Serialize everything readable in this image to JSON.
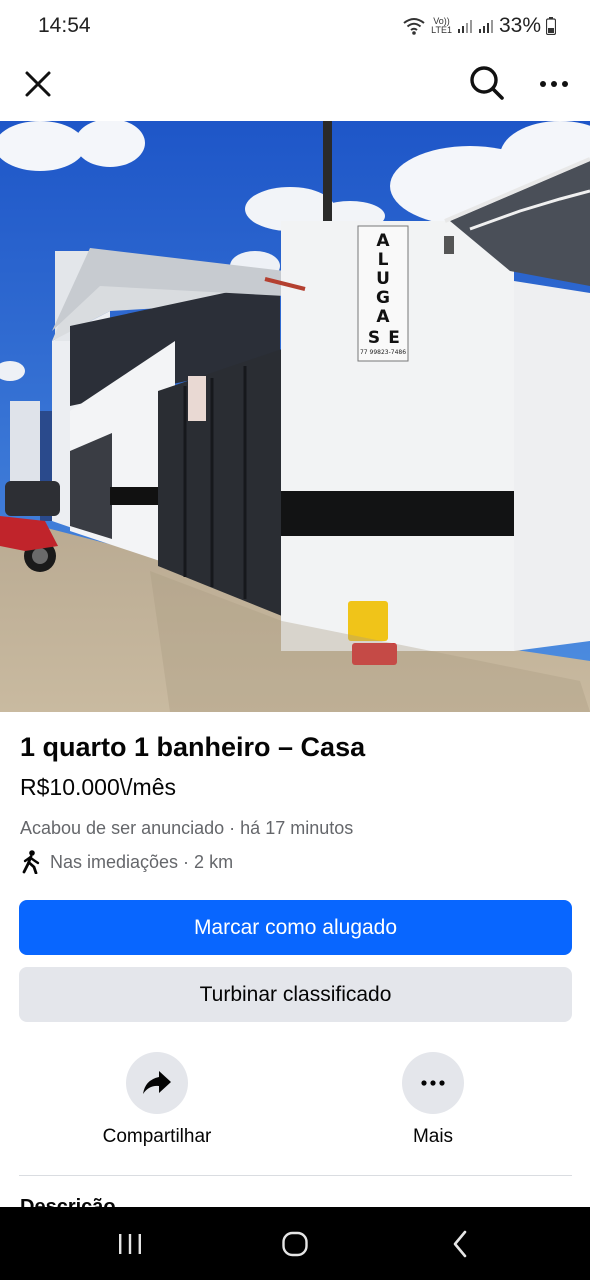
{
  "status_bar": {
    "time": "14:54",
    "network_label_top": "Vo))",
    "network_label_bottom": "LTE1",
    "battery": "33%"
  },
  "app_bar": {
    "close_icon": "close-icon",
    "search_icon": "search-icon",
    "more_icon": "more-horizontal-icon"
  },
  "photo": {
    "sign_letters": [
      "A",
      "L",
      "U",
      "G",
      "A",
      "S",
      "E"
    ],
    "sign_phone": "77 99823-7486"
  },
  "listing": {
    "title": "1 quarto 1 banheiro – Casa",
    "price": "R$10.000\\/mês",
    "posted": "Acabou de ser anunciado",
    "posted_time": " · há 17 minutos",
    "location_icon": "walking-person-icon",
    "location": "Nas imediações · 2 km"
  },
  "buttons": {
    "primary": "Marcar como alugado",
    "secondary": "Turbinar classificado"
  },
  "actions": [
    {
      "label": "Compartilhar",
      "icon": "share-icon"
    },
    {
      "label": "Mais",
      "icon": "more-horizontal-icon"
    }
  ],
  "section_partial": "Descrição",
  "colors": {
    "primary_button": "#0866ff",
    "secondary_button": "#e4e6eb",
    "muted_text": "#65676b"
  }
}
